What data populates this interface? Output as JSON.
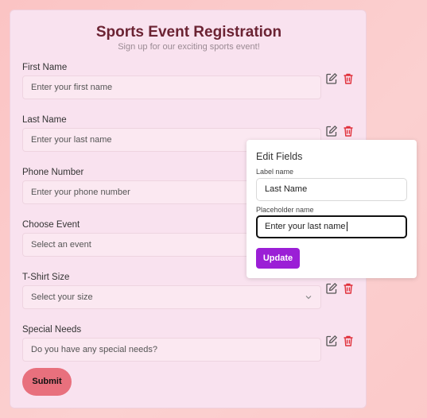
{
  "form": {
    "title": "Sports Event Registration",
    "subtitle": "Sign up for our exciting sports event!",
    "fields": [
      {
        "label": "First Name",
        "placeholder": "Enter your first name"
      },
      {
        "label": "Last Name",
        "placeholder": "Enter your last name"
      },
      {
        "label": "Phone Number",
        "placeholder": "Enter your phone number"
      },
      {
        "label": "Choose Event",
        "placeholder": "Select an event"
      },
      {
        "label": "T-Shirt Size",
        "placeholder": "Select your size"
      },
      {
        "label": "Special Needs",
        "placeholder": "Do you have any special needs?"
      }
    ],
    "submit_label": "Submit"
  },
  "popup": {
    "title": "Edit Fields",
    "label_name_label": "Label name",
    "label_name_value": "Last Name",
    "placeholder_name_label": "Placeholder name",
    "placeholder_name_value": "Enter your last name",
    "update_label": "Update"
  },
  "icons": {
    "edit": "edit-icon",
    "delete": "trash-icon",
    "dropdown": "chevron-down-icon"
  },
  "colors": {
    "background": "#fbc4c4",
    "card": "#f9e2ef",
    "title": "#6b2333",
    "submit": "#e8707d",
    "update": "#9b1fd6",
    "delete_icon": "#e0303a"
  }
}
